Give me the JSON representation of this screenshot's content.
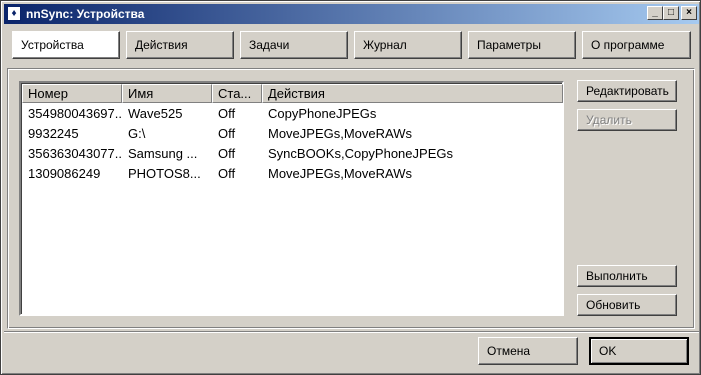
{
  "window": {
    "title": "nnSync: Устройства",
    "icon": "app-icon",
    "controls": {
      "minimize": "_",
      "maximize": "□",
      "close": "×"
    }
  },
  "tabs": [
    {
      "label": "Устройства",
      "active": true
    },
    {
      "label": "Действия",
      "active": false
    },
    {
      "label": "Задачи",
      "active": false
    },
    {
      "label": "Журнал",
      "active": false
    },
    {
      "label": "Параметры",
      "active": false
    },
    {
      "label": "О программе",
      "active": false
    }
  ],
  "devices_table": {
    "columns": [
      "Номер",
      "Имя",
      "Ста...",
      "Действия"
    ],
    "rows": [
      [
        "354980043697...",
        "Wave525",
        "Off",
        "CopyPhoneJPEGs"
      ],
      [
        "9932245",
        "G:\\",
        "Off",
        "MoveJPEGs,MoveRAWs"
      ],
      [
        "356363043077...",
        "Samsung ...",
        "Off",
        "SyncBOOKs,CopyPhoneJPEGs"
      ],
      [
        "1309086249",
        "PHOTOS8...",
        "Off",
        "MoveJPEGs,MoveRAWs"
      ]
    ]
  },
  "side_buttons": {
    "edit": "Редактировать",
    "delete": "Удалить",
    "run": "Выполнить",
    "refresh": "Обновить"
  },
  "footer": {
    "cancel": "Отмена",
    "ok": "OK"
  }
}
